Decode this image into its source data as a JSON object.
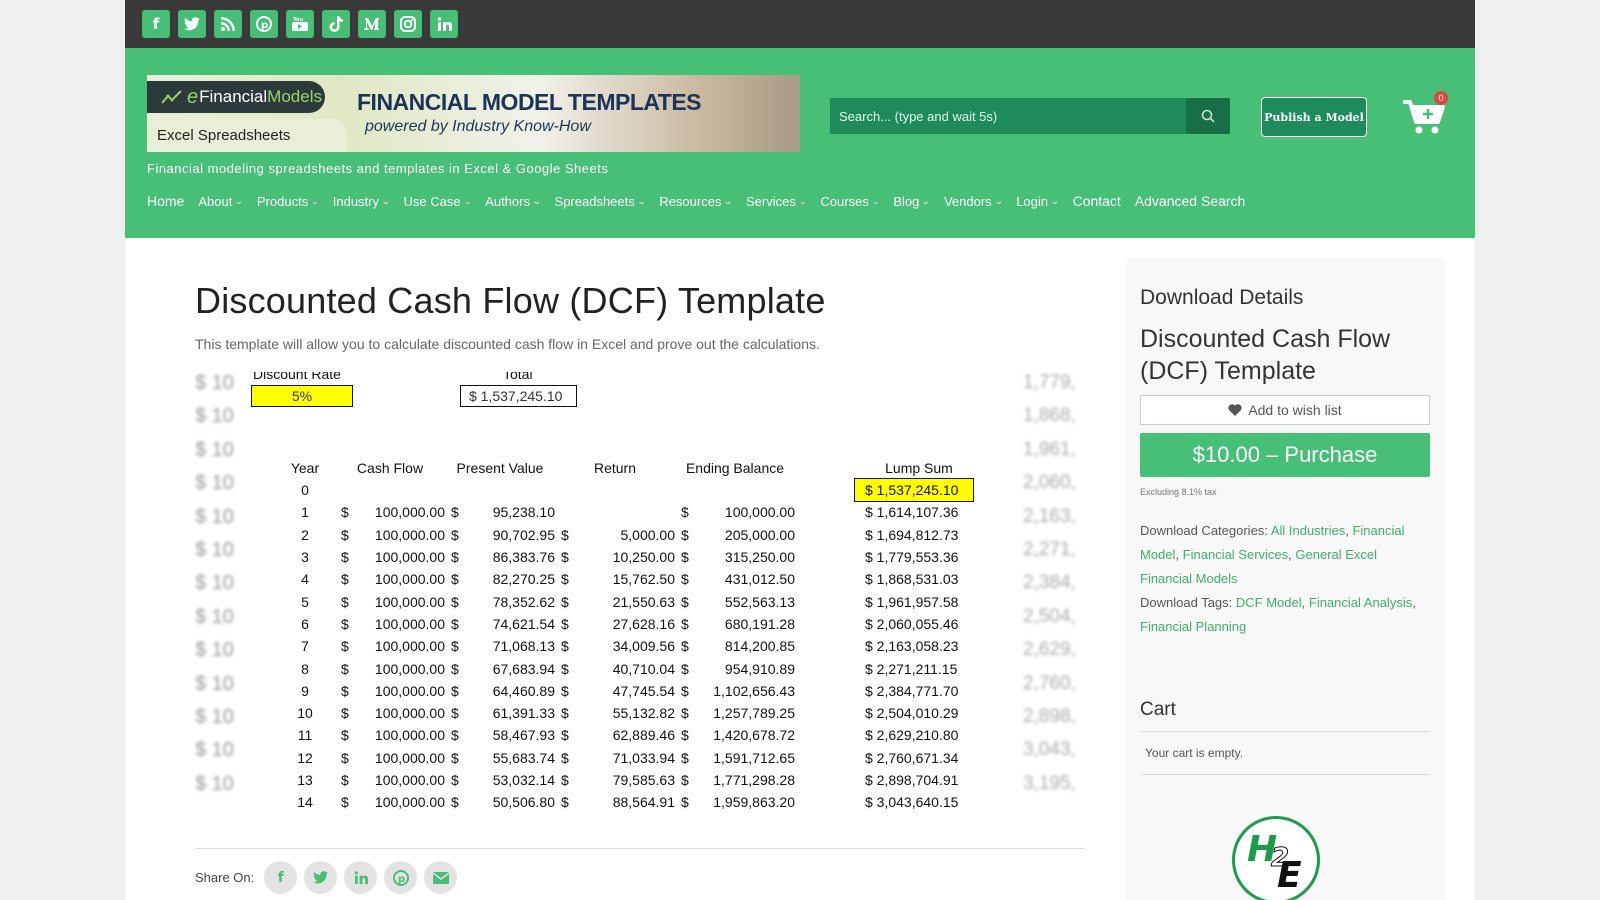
{
  "social": [
    "f",
    "t",
    "rss",
    "p",
    "yt",
    "tt",
    "m",
    "ig",
    "in"
  ],
  "brand": {
    "logo_e": "e",
    "logo_fin": "Financial",
    "logo_mod": "Models",
    "excel_tag": "Excel Spreadsheets",
    "banner_title": "FINANCIAL MODEL TEMPLATES",
    "banner_sub": "powered by Industry Know-How",
    "tagline": "Financial modeling spreadsheets and templates in Excel & Google Sheets"
  },
  "search": {
    "placeholder": "Search... (type and wait 5s)"
  },
  "publish_label": "Publish a Model",
  "cart_count": "0",
  "nav": [
    {
      "label": "Home",
      "dropdown": false
    },
    {
      "label": "About",
      "dropdown": true
    },
    {
      "label": "Products",
      "dropdown": true
    },
    {
      "label": "Industry",
      "dropdown": true
    },
    {
      "label": "Use Case",
      "dropdown": true
    },
    {
      "label": "Authors",
      "dropdown": true
    },
    {
      "label": "Spreadsheets",
      "dropdown": true
    },
    {
      "label": "Resources",
      "dropdown": true
    },
    {
      "label": "Services",
      "dropdown": true
    },
    {
      "label": "Courses",
      "dropdown": true
    },
    {
      "label": "Blog",
      "dropdown": true
    },
    {
      "label": "Vendors",
      "dropdown": true
    },
    {
      "label": "Login",
      "dropdown": true
    },
    {
      "label": "Contact",
      "dropdown": false
    },
    {
      "label": "Advanced Search",
      "dropdown": false
    }
  ],
  "product": {
    "title": "Discounted Cash Flow (DCF) Template",
    "intro": "This template will allow you to calculate discounted cash flow in Excel and prove out the calculations."
  },
  "sheet": {
    "discount_label": "Discount Rate",
    "discount_value": "5%",
    "total_label": "Total",
    "total_value": "$  1,537,245.10",
    "headers": {
      "year": "Year",
      "cash_flow": "Cash Flow",
      "pv": "Present Value",
      "ret": "Return",
      "end": "Ending Balance",
      "lump": "Lump Sum"
    },
    "rows": [
      {
        "year": "0",
        "cf": "",
        "pv": "",
        "ret": "",
        "end": "",
        "lump": "$ 1,537,245.10"
      },
      {
        "year": "1",
        "cf": "100,000.00",
        "pv": "95,238.10",
        "ret": "",
        "end": "100,000.00",
        "lump": "$ 1,614,107.36"
      },
      {
        "year": "2",
        "cf": "100,000.00",
        "pv": "90,702.95",
        "ret": "5,000.00",
        "end": "205,000.00",
        "lump": "$ 1,694,812.73"
      },
      {
        "year": "3",
        "cf": "100,000.00",
        "pv": "86,383.76",
        "ret": "10,250.00",
        "end": "315,250.00",
        "lump": "$ 1,779,553.36"
      },
      {
        "year": "4",
        "cf": "100,000.00",
        "pv": "82,270.25",
        "ret": "15,762.50",
        "end": "431,012.50",
        "lump": "$ 1,868,531.03"
      },
      {
        "year": "5",
        "cf": "100,000.00",
        "pv": "78,352.62",
        "ret": "21,550.63",
        "end": "552,563.13",
        "lump": "$ 1,961,957.58"
      },
      {
        "year": "6",
        "cf": "100,000.00",
        "pv": "74,621.54",
        "ret": "27,628.16",
        "end": "680,191.28",
        "lump": "$ 2,060,055.46"
      },
      {
        "year": "7",
        "cf": "100,000.00",
        "pv": "71,068.13",
        "ret": "34,009.56",
        "end": "814,200.85",
        "lump": "$ 2,163,058.23"
      },
      {
        "year": "8",
        "cf": "100,000.00",
        "pv": "67,683.94",
        "ret": "40,710.04",
        "end": "954,910.89",
        "lump": "$ 2,271,211.15"
      },
      {
        "year": "9",
        "cf": "100,000.00",
        "pv": "64,460.89",
        "ret": "47,745.54",
        "end": "1,102,656.43",
        "lump": "$ 2,384,771.70"
      },
      {
        "year": "10",
        "cf": "100,000.00",
        "pv": "61,391.33",
        "ret": "55,132.82",
        "end": "1,257,789.25",
        "lump": "$ 2,504,010.29"
      },
      {
        "year": "11",
        "cf": "100,000.00",
        "pv": "58,467.93",
        "ret": "62,889.46",
        "end": "1,420,678.72",
        "lump": "$ 2,629,210.80"
      },
      {
        "year": "12",
        "cf": "100,000.00",
        "pv": "55,683.74",
        "ret": "71,033.94",
        "end": "1,591,712.65",
        "lump": "$ 2,760,671.34"
      },
      {
        "year": "13",
        "cf": "100,000.00",
        "pv": "53,032.14",
        "ret": "79,585.63",
        "end": "1,771,298.28",
        "lump": "$ 2,898,704.91"
      },
      {
        "year": "14",
        "cf": "100,000.00",
        "pv": "50,506.80",
        "ret": "88,564.91",
        "end": "1,959,863.20",
        "lump": "$ 3,043,640.15"
      }
    ],
    "ghost_right": [
      "1,779,",
      "1,868,",
      "1,961,",
      "2,060,",
      "2,163,",
      "2,271,",
      "2,384,",
      "2,504,",
      "2,629,",
      "2,760,",
      "2,898,",
      "3,043,",
      "3,195,"
    ]
  },
  "share": {
    "label": "Share On:",
    "icons": [
      "f",
      "t",
      "in",
      "p",
      "mail"
    ]
  },
  "sidebar": {
    "heading": "Download Details",
    "title": "Discounted Cash Flow (DCF) Template",
    "wishlist": "Add to wish list",
    "purchase": "$10.00 – Purchase",
    "tax": "Excluding 8.1% tax",
    "cat_label": "Download Categories:",
    "categories": [
      "All Industries",
      "Financial Model",
      "Financial Services",
      "General Excel Financial Models"
    ],
    "tag_label": "Download Tags:",
    "tags": [
      "DCF Model",
      "Financial Analysis",
      "Financial Planning"
    ],
    "cart_title": "Cart",
    "cart_empty": "Your cart is empty."
  },
  "colors": {
    "brand_green": "#47bf77",
    "topbar": "#3a3a3a",
    "highlight": "#ffff00"
  }
}
